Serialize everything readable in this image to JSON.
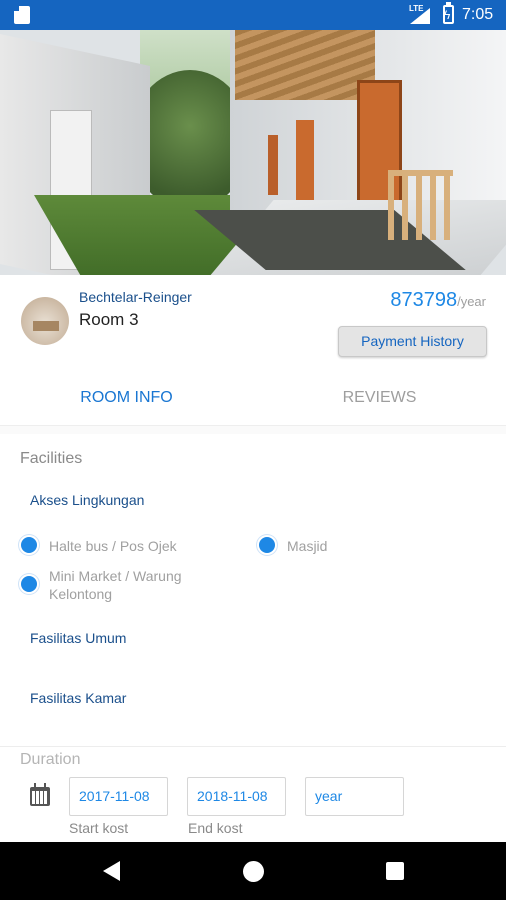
{
  "status_bar": {
    "network": "LTE",
    "time": "7:05"
  },
  "listing": {
    "owner": "Bechtelar-Reinger",
    "room": "Room 3",
    "price": "873798",
    "price_unit": "/year",
    "payment_history_label": "Payment History"
  },
  "tabs": [
    {
      "label": "ROOM INFO",
      "active": true
    },
    {
      "label": "REVIEWS",
      "active": false
    }
  ],
  "facilities": {
    "title": "Facilities",
    "categories": [
      {
        "name": "Akses Lingkungan",
        "items": [
          "Halte bus / Pos Ojek",
          "Masjid",
          "Mini Market / Warung Kelontong"
        ]
      },
      {
        "name": "Fasilitas Umum",
        "items": []
      },
      {
        "name": "Fasilitas Kamar",
        "items": []
      }
    ]
  },
  "duration": {
    "title": "Duration",
    "start_value": "2017-11-08",
    "start_label": "Start kost",
    "end_value": "2018-11-08",
    "end_label": "End kost",
    "period_value": "year"
  },
  "colors": {
    "primary": "#1565c0",
    "accent": "#1e88e5",
    "link": "#1a4f8b"
  }
}
